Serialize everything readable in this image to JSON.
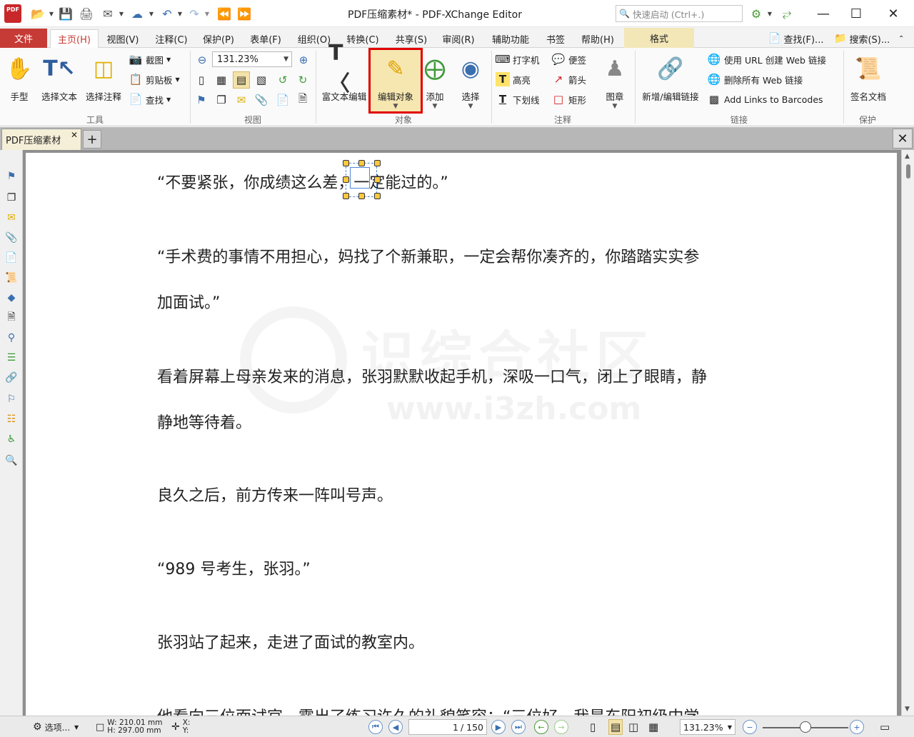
{
  "window": {
    "title": "PDF压缩素材* - PDF-XChange Editor"
  },
  "quick_launch": {
    "placeholder": "快速启动 (Ctrl+.)"
  },
  "menu": {
    "file": "文件",
    "tabs": [
      "主页(H)",
      "视图(V)",
      "注释(C)",
      "保护(P)",
      "表单(F)",
      "组织(O)",
      "转换(C)",
      "共享(S)",
      "审阅(R)",
      "辅助功能",
      "书签",
      "帮助(H)"
    ],
    "format": "格式",
    "find": "查找(F)...",
    "search": "搜索(S)..."
  },
  "ribbon": {
    "tools": {
      "label": "工具",
      "hand": "手型",
      "select_text": "选择文本",
      "select_comment": "选择注释",
      "snapshot": "截图",
      "clipboard": "剪贴板",
      "find": "查找"
    },
    "view": {
      "label": "视图",
      "zoom": "131.23%"
    },
    "objects": {
      "label": "对象",
      "rich_text_edit": "富文本编辑",
      "edit_object": "编辑对象",
      "add": "添加",
      "select": "选择"
    },
    "comments": {
      "label": "注释",
      "typewriter": "打字机",
      "sticky_note": "便签",
      "highlight": "高亮",
      "arrow": "箭头",
      "underline": "下划线",
      "rectangle": "矩形",
      "stamp": "图章"
    },
    "links": {
      "label": "链接",
      "add_edit_link": "新增/编辑链接",
      "create_web_links": "使用 URL 创建 Web 链接",
      "remove_web_links": "删除所有 Web 链接",
      "add_barcode_links": "Add Links to Barcodes"
    },
    "protect": {
      "label": "保护",
      "sign_document": "签名文档"
    }
  },
  "doc_tab": {
    "name": "PDF压缩素材"
  },
  "document": {
    "paragraphs": [
      "“不要紧张，你成绩这么差，一定能过的。”",
      "“手术费的事情不用担心，妈找了个新兼职，一定会帮你凑齐的，你踏踏实实参",
      "加面试。”",
      "看着屏幕上母亲发来的消息，张羽默默收起手机，深吸一口气，闭上了眼睛，静",
      "静地等待着。",
      "良久之后，前方传来一阵叫号声。",
      "“989 号考生，张羽。”",
      "张羽站了起来，走进了面试的教室内。",
      "他看向三位面试官，露出了练习许久的礼貌笑容：“三位好，我是东阳初级中学"
    ],
    "watermark": {
      "text": "识综合社区",
      "url": "www.i3zh.com"
    }
  },
  "status": {
    "options": "选项...",
    "width": "W: 210.01 mm",
    "height": "H: 297.00 mm",
    "x": "X:",
    "y": "Y:",
    "page": "1",
    "page_total": "/ 150",
    "zoom": "131.23%"
  }
}
